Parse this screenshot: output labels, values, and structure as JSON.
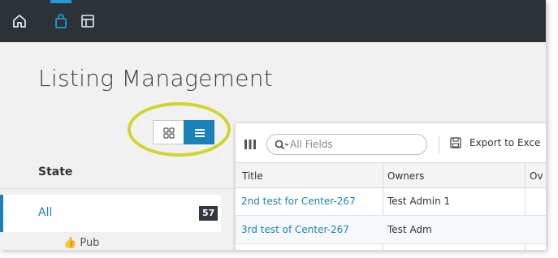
{
  "topbar": {
    "icons": [
      "home-icon",
      "shopping-bag-icon",
      "layout-icon"
    ],
    "active_icon": "shopping-bag-icon",
    "background": "#2c3338",
    "accent": "#1e9ad6"
  },
  "page": {
    "title": "Listing Management"
  },
  "view_toggle": {
    "options": [
      "grid-view-icon",
      "list-view-icon"
    ],
    "selected": "list-view-icon",
    "highlight_color": "#cfd52a"
  },
  "states": {
    "heading": "State",
    "items": [
      {
        "label": "All",
        "count": "57",
        "selected": true
      },
      {
        "label": "Pub",
        "icon": "thumbs-up-icon"
      }
    ]
  },
  "grid": {
    "search": {
      "placeholder": "All Fields",
      "value": ""
    },
    "export_label": "Export to Exce",
    "columns": [
      "Title",
      "Owners",
      "Ov"
    ],
    "rows": [
      {
        "title": "2nd test for Center-267",
        "owners": "Test Admin 1"
      },
      {
        "title": "3rd test of Center-267",
        "owners": "Test Adm"
      }
    ]
  },
  "colors": {
    "link": "#1b82b8",
    "badge": "#33393e"
  }
}
